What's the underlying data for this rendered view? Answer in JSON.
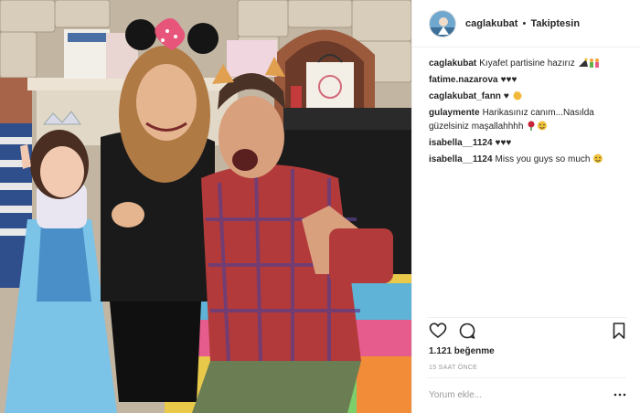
{
  "header": {
    "username": "caglakubat",
    "separator": "•",
    "follow_status": "Takiptesin"
  },
  "comments": [
    {
      "user": "caglakubat",
      "text": "Kıyafet partisine hazırız",
      "emojis": [
        "party-hat-emoji",
        "family-emoji"
      ]
    },
    {
      "user": "fatime.nazarova",
      "text": "♥♥♥",
      "emojis": []
    },
    {
      "user": "caglakubat_fann",
      "text": "♥",
      "emojis": [
        "clap-emoji"
      ]
    },
    {
      "user": "gulaymente",
      "text": "Harikasınız canım...Nasılda güzelsiniz maşallahhhh",
      "emojis": [
        "rose-emoji",
        "smile-emoji"
      ]
    },
    {
      "user": "isabella__1124",
      "text": "♥♥♥",
      "emojis": []
    },
    {
      "user": "isabella__1124",
      "text": "Miss you guys so much",
      "emojis": [
        "smile-emoji"
      ]
    }
  ],
  "actions": {
    "like_icon": "heart-icon",
    "comment_icon": "comment-bubble-icon",
    "save_icon": "bookmark-icon"
  },
  "likes": "1.121 beğenme",
  "timestamp": "15 SAAT ÖNCE",
  "comment_box": {
    "placeholder": "Yorum ekle...",
    "more_icon": "ellipsis-icon"
  },
  "colors": {
    "text": "#262626",
    "muted": "#999999",
    "border": "#efefef"
  }
}
